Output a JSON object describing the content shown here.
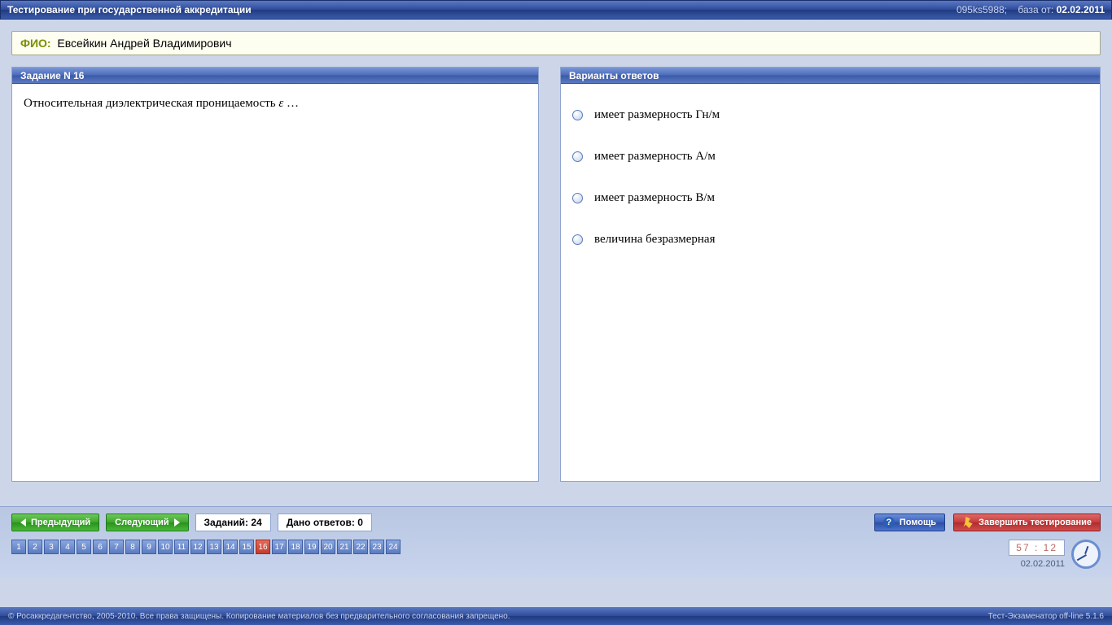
{
  "title": "Тестирование при государственной аккредитации",
  "session_id": "095ks5988;",
  "db_label": "база от:",
  "db_date": "02.02.2011",
  "fio": {
    "label": "ФИО:",
    "value": "Евсейкин Андрей Владимирович"
  },
  "question": {
    "header": "Задание N 16",
    "text_pre": "Относительная диэлектрическая проницаемость ",
    "symbol": "ε",
    "text_post": " …"
  },
  "answers": {
    "header": "Варианты ответов",
    "items": [
      "имеет размерность Гн/м",
      "имеет размерность А/м",
      "имеет размерность В/м",
      "величина безразмерная"
    ]
  },
  "nav": {
    "prev": "Предыдущий",
    "next": "Следующий",
    "total_label": "Заданий: 24",
    "answered_label": "Дано ответов: 0",
    "help": "Помощь",
    "finish": "Завершить тестирование",
    "count": 24,
    "current": 16
  },
  "clock": {
    "time": "57 : 12",
    "date": "02.02.2011"
  },
  "footer": {
    "left": "© Росаккредагентство, 2005-2010. Все права защищены. Копирование материалов без предварительного согласования запрещено.",
    "right": "Тест-Экзаменатор off-line 5.1.6"
  }
}
